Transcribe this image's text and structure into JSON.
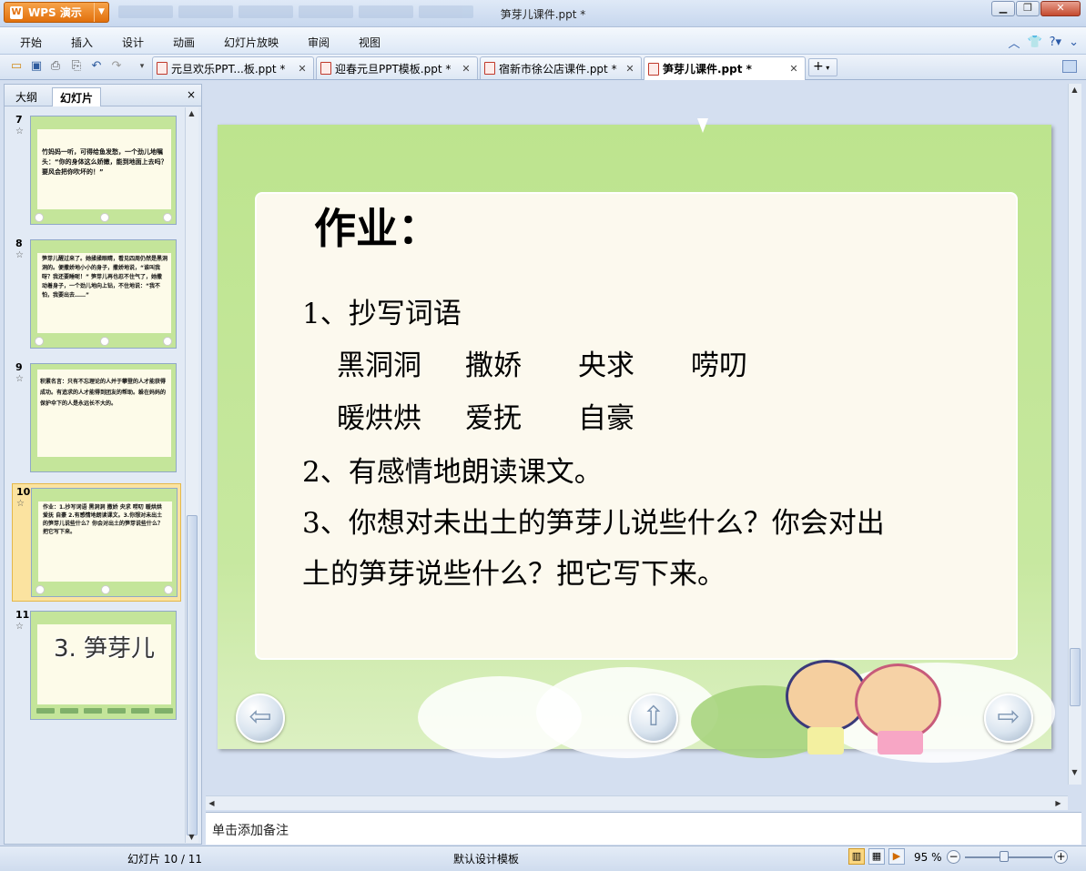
{
  "app": {
    "name": "WPS 演示",
    "window_title": "笋芽儿课件.ppt *"
  },
  "menu": [
    "开始",
    "插入",
    "设计",
    "动画",
    "幻灯片放映",
    "审阅",
    "视图"
  ],
  "tabs": [
    {
      "label": "元旦欢乐PPT...板.ppt *",
      "active": false
    },
    {
      "label": "迎春元旦PPT模板.ppt *",
      "active": false
    },
    {
      "label": "宿新市徐公店课件.ppt *",
      "active": false
    },
    {
      "label": "笋芽儿课件.ppt *",
      "active": true
    }
  ],
  "panel": {
    "tab_outline": "大纲",
    "tab_slides": "幻灯片",
    "close": "×",
    "slides": [
      {
        "num": "7",
        "text": "竹妈妈一听，可得给鱼发愁，一个劲儿地嘱头：“你的身体这么娇嫩，能到地面上去吗？要风会把你吹坏的！”"
      },
      {
        "num": "8",
        "text": "笋芽儿醒过来了。她揉揉眼睛，看见四周仍然是黑洞洞的。便撒娇地小小的身子，撒娇地说，“谁叫我呀？我还要睡呢！” 笋芽儿再也忍不住气了，她撒动着身子，一个劲儿地向上钻，不住地说：“我不怕，我要出去……”"
      },
      {
        "num": "9",
        "text": "积累名言：只有不忘理论的人并于攀登的人才能获得成功。有追求的人才能得到团友的帮助。躲在妈妈的保护伞下的人是永远长不大的。"
      },
      {
        "num": "10",
        "text": "作业：1.抄写词语 黑洞洞 撒娇 央求 唠叨 暖烘烘 爱抚 自豪 2.有感情地朗读课文。3.你想对未出土的笋芽儿说些什么？你会对出土的笋芽说些什么？把它写下来。"
      },
      {
        "num": "11",
        "text": "3. 笋芽儿"
      }
    ]
  },
  "slide": {
    "title": "作业：",
    "line1": "1、抄写词语",
    "words": [
      "黑洞洞",
      "撒娇",
      "央求",
      "唠叨",
      "暖烘烘",
      "爱抚",
      "自豪"
    ],
    "line2": "2、有感情地朗读课文。",
    "line3a": "3、你想对未出土的笋芽儿说些什么？你会对出",
    "line3b": "土的笋芽说些什么？把它写下来。"
  },
  "notes_placeholder": "单击添加备注",
  "status": {
    "slide_counter": "幻灯片 10 / 11",
    "template": "默认设计模板",
    "zoom": "95 %",
    "zoom_fraction": 0.45
  }
}
